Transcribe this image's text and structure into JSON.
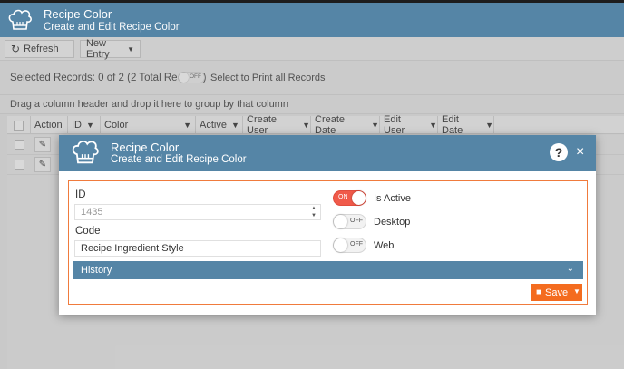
{
  "app": {
    "title": "Recipe Color",
    "subtitle": "Create and Edit Recipe Color",
    "icon": "chef-hat-icon",
    "header_color": "#5585a6"
  },
  "toolbar": {
    "refresh_label": "Refresh",
    "new_entry_label": "New Entry"
  },
  "info": {
    "selected_records": "Selected Records: 0 of 2 (2 Total Records)",
    "print_toggle_state": "OFF",
    "print_label": "Select to Print all Records",
    "group_hint": "Drag a column header and drop it here to group by that column"
  },
  "grid": {
    "columns": [
      "Action",
      "ID",
      "Color",
      "Active",
      "Create User",
      "Create Date",
      "Edit User",
      "Edit Date"
    ],
    "row_count": 2
  },
  "modal": {
    "title": "Recipe Color",
    "subtitle": "Create and Edit Recipe Color",
    "help_label": "?",
    "close_label": "×",
    "id_label": "ID",
    "id_value": "1435",
    "code_label": "Code",
    "code_value": "Recipe Ingredient Style",
    "switches": [
      {
        "state": "ON",
        "label": "Is Active"
      },
      {
        "state": "OFF",
        "label": "Desktop"
      },
      {
        "state": "OFF",
        "label": "Web"
      }
    ],
    "history_label": "History",
    "save_label": "Save",
    "accent_color": "#f46c1f",
    "border_color": "#f07b3d"
  }
}
